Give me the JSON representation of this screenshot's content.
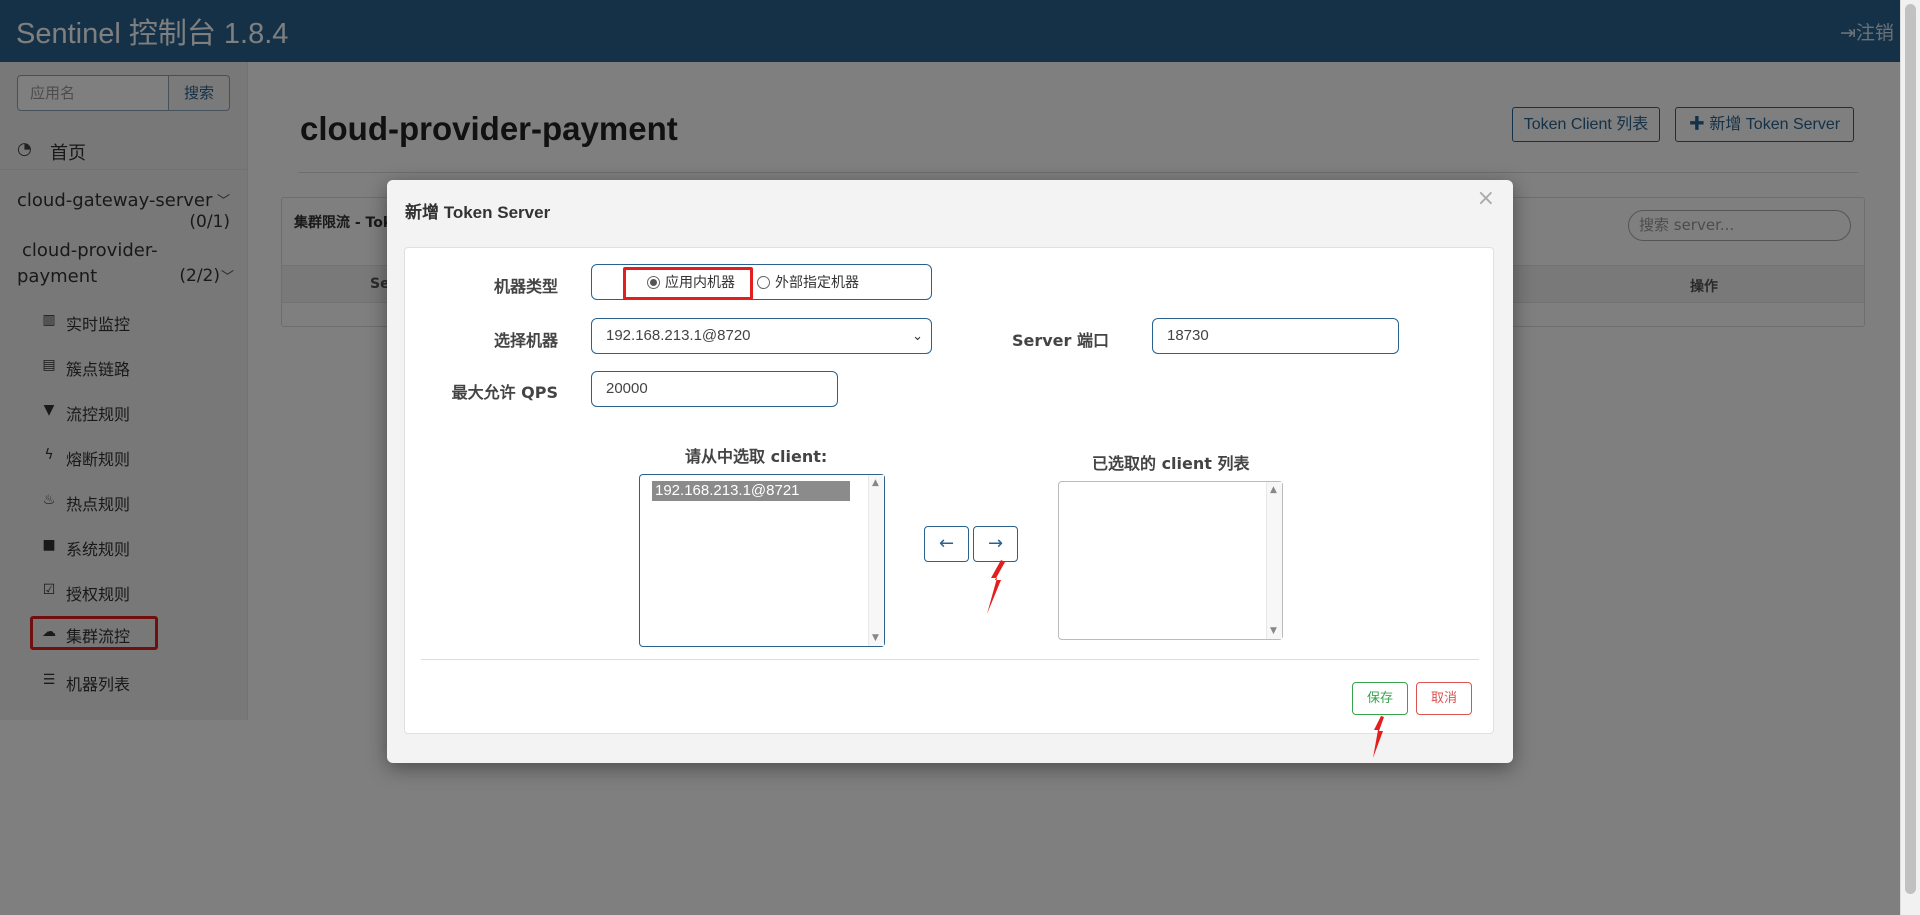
{
  "header": {
    "brand": "Sentinel 控制台 1.8.4",
    "logout_label": "注销",
    "logout_icon": "sign-out-icon"
  },
  "sidebar": {
    "search_placeholder": "应用名",
    "search_button": "搜索",
    "home_label": "首页",
    "apps": [
      {
        "name": "cloud-gateway-server",
        "count": "(0/1)"
      },
      {
        "name_line1": "cloud-provider-",
        "name_line2": "payment",
        "count": "(2/2)"
      }
    ],
    "menu": [
      {
        "label": "实时监控",
        "icon": "bar-chart-icon"
      },
      {
        "label": "簇点链路",
        "icon": "list-alt-icon"
      },
      {
        "label": "流控规则",
        "icon": "filter-icon"
      },
      {
        "label": "熔断规则",
        "icon": "flash-icon"
      },
      {
        "label": "热点规则",
        "icon": "fire-icon"
      },
      {
        "label": "系统规则",
        "icon": "lock-icon"
      },
      {
        "label": "授权规则",
        "icon": "check-icon"
      },
      {
        "label": "集群流控",
        "icon": "cloud-icon"
      },
      {
        "label": "机器列表",
        "icon": "th-list-icon"
      }
    ]
  },
  "main": {
    "title": "cloud-provider-payment",
    "token_client_button": "Token Client 列表",
    "add_token_server_button": "新增 Token Server",
    "panel_title": "集群限流 - Tok",
    "search_server_placeholder": "搜索 server...",
    "col_first": "Se",
    "col_ops": "操作"
  },
  "modal": {
    "title": "新增 Token Server",
    "close": "×",
    "machine_type_label": "机器类型",
    "radio_internal": "应用内机器",
    "radio_external": "外部指定机器",
    "radio_selected": "应用内机器",
    "select_machine_label": "选择机器",
    "select_machine_value": "192.168.213.1@8720",
    "server_port_label": "Server 端口",
    "server_port_value": "18730",
    "max_qps_label": "最大允许 QPS",
    "max_qps_value": "20000",
    "available_clients_title": "请从中选取 client:",
    "available_clients": [
      "192.168.213.1@8721"
    ],
    "selected_clients_title": "已选取的 client 列表",
    "selected_clients": [],
    "move_left": "←",
    "move_right": "→",
    "save": "保存",
    "cancel": "取消"
  }
}
